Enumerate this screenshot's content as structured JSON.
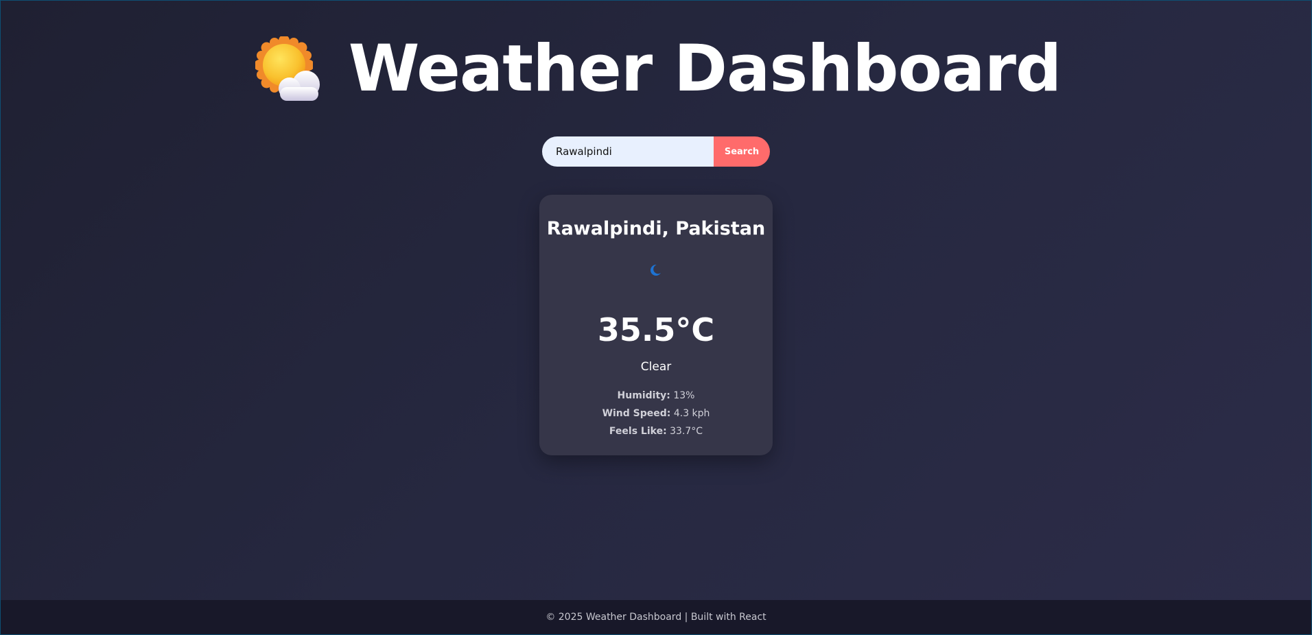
{
  "header": {
    "title": "Weather Dashboard",
    "icon": "sun-behind-cloud-icon"
  },
  "search": {
    "value": "Rawalpindi",
    "placeholder": "",
    "button_label": "Search"
  },
  "weather": {
    "location": "Rawalpindi, Pakistan",
    "condition_icon": "crescent-moon-icon",
    "temperature": "35.5°C",
    "condition": "Clear",
    "humidity_label": "Humidity:",
    "humidity_value": "13%",
    "wind_label": "Wind Speed:",
    "wind_value": "4.3 kph",
    "feels_like_label": "Feels Like:",
    "feels_like_value": "33.7°C"
  },
  "footer": {
    "text": "© 2025 Weather Dashboard | Built with React"
  },
  "colors": {
    "accent": "#ff6b6b",
    "card": "#363649",
    "input_bg": "#e8f0fe",
    "footer_bg": "#181829"
  }
}
